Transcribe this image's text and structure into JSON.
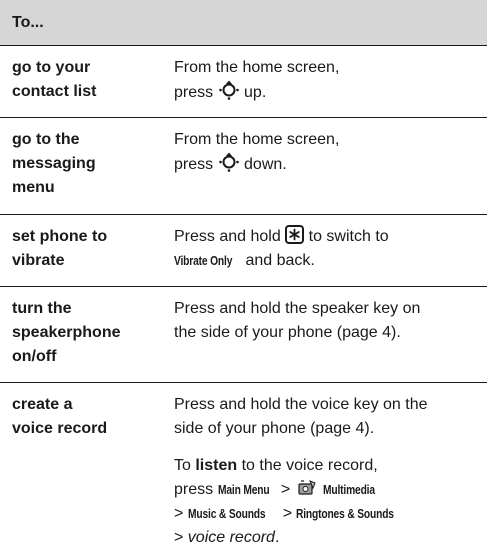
{
  "header": {
    "title": "To..."
  },
  "rows": [
    {
      "label_l1": "go to your",
      "label_l2": "contact list",
      "desc_l1": "From the home screen,",
      "desc_pre": "press",
      "desc_post": "up."
    },
    {
      "label_l1": "go to the",
      "label_l2": "messaging",
      "label_l3": "menu",
      "desc_l1": "From the home screen,",
      "desc_pre": "press",
      "desc_post": "down."
    },
    {
      "label_l1": "set phone to",
      "label_l2": "vibrate",
      "desc_pre": "Press and hold",
      "desc_post": "to switch to",
      "desc_small": "Vibrate Only",
      "desc_end": "and back."
    },
    {
      "label_l1": "turn the",
      "label_l2": "speakerphone",
      "label_l3": "on/off",
      "desc_l1": "Press and hold the speaker key on",
      "desc_l2": "the side of your phone (page 4)."
    },
    {
      "label_l1": "create a",
      "label_l2": "voice record",
      "desc_l1": "Press and hold the voice key on the",
      "desc_l2": "side of your phone (page 4).",
      "listen_pre": "To",
      "listen_bold": "listen",
      "listen_post": "to the voice record,",
      "press": "press",
      "main_menu": "Main Menu",
      "gt": ">",
      "multimedia": "Multimedia",
      "music_sounds": "Music & Sounds",
      "ringtones": "Ringtones & Sounds",
      "voice_record": "voice record",
      "period": "."
    }
  ],
  "icons": {
    "nav": "nav-key-icon",
    "star": "star-key-icon",
    "multimedia": "multimedia-icon"
  }
}
